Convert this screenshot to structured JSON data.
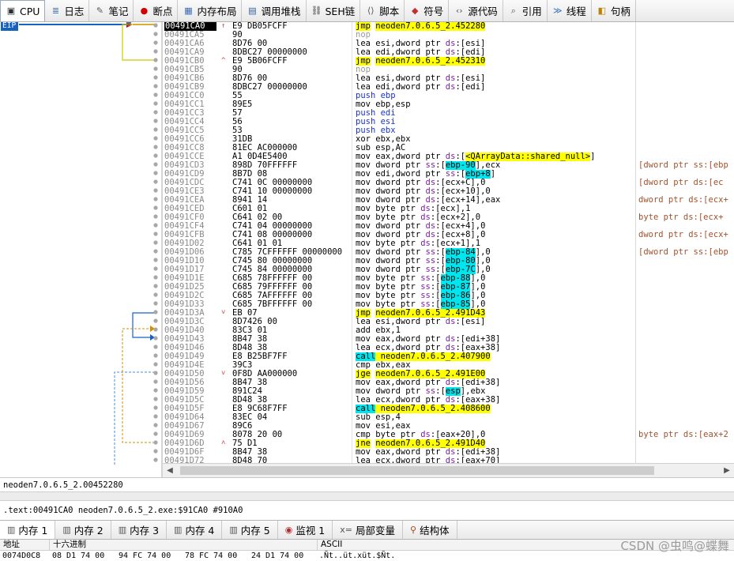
{
  "tabs": [
    {
      "label": "CPU",
      "icon": "cpu-icon",
      "active": true
    },
    {
      "label": "日志",
      "icon": "log-icon"
    },
    {
      "label": "笔记",
      "icon": "notes-icon"
    },
    {
      "label": "断点",
      "icon": "breakpoint-icon"
    },
    {
      "label": "内存布局",
      "icon": "memory-map-icon"
    },
    {
      "label": "调用堆栈",
      "icon": "call-stack-icon"
    },
    {
      "label": "SEH链",
      "icon": "seh-chain-icon"
    },
    {
      "label": "脚本",
      "icon": "script-icon"
    },
    {
      "label": "符号",
      "icon": "symbols-icon"
    },
    {
      "label": "源代码",
      "icon": "source-icon"
    },
    {
      "label": "引用",
      "icon": "references-icon"
    },
    {
      "label": "线程",
      "icon": "threads-icon"
    },
    {
      "label": "句柄",
      "icon": "handles-icon"
    }
  ],
  "eip_label": "EIP",
  "disasm": [
    {
      "addr": "00491CA0",
      "hex": "E9 DB05FCFF",
      "mark": "↑",
      "parts": [
        [
          "jmp",
          "jmp"
        ],
        [
          " "
        ],
        [
          "neoden7.0.6.5_2.452280",
          "jmp"
        ]
      ],
      "sel": true
    },
    {
      "addr": "00491CA5",
      "hex": "90",
      "parts": [
        [
          "nop",
          "nop"
        ]
      ]
    },
    {
      "addr": "00491CA6",
      "hex": "8D76 00",
      "parts": [
        [
          "lea esi,dword ptr "
        ],
        [
          "ds",
          "seg"
        ],
        [
          ":[esi]"
        ]
      ]
    },
    {
      "addr": "00491CA9",
      "hex": "8DBC27 00000000",
      "parts": [
        [
          "lea edi,dword ptr "
        ],
        [
          "ds",
          "seg"
        ],
        [
          ":[edi]"
        ]
      ]
    },
    {
      "addr": "00491CB0",
      "hex": "E9 5B06FCFF",
      "mark": "^",
      "parts": [
        [
          "jmp",
          "jmp"
        ],
        [
          " "
        ],
        [
          "neoden7.0.6.5_2.452310",
          "jmp"
        ]
      ]
    },
    {
      "addr": "00491CB5",
      "hex": "90",
      "parts": [
        [
          "nop",
          "nop"
        ]
      ]
    },
    {
      "addr": "00491CB6",
      "hex": "8D76 00",
      "parts": [
        [
          "lea esi,dword ptr "
        ],
        [
          "ds",
          "seg"
        ],
        [
          ":[esi]"
        ]
      ]
    },
    {
      "addr": "00491CB9",
      "hex": "8DBC27 00000000",
      "parts": [
        [
          "lea edi,dword ptr "
        ],
        [
          "ds",
          "seg"
        ],
        [
          ":[edi]"
        ]
      ]
    },
    {
      "addr": "00491CC0",
      "hex": "55",
      "parts": [
        [
          "push ebp",
          "push"
        ]
      ]
    },
    {
      "addr": "00491CC1",
      "hex": "89E5",
      "parts": [
        [
          "mov ebp,esp"
        ]
      ]
    },
    {
      "addr": "00491CC3",
      "hex": "57",
      "parts": [
        [
          "push edi",
          "push"
        ]
      ]
    },
    {
      "addr": "00491CC4",
      "hex": "56",
      "parts": [
        [
          "push esi",
          "push"
        ]
      ]
    },
    {
      "addr": "00491CC5",
      "hex": "53",
      "parts": [
        [
          "push ebx",
          "push"
        ]
      ]
    },
    {
      "addr": "00491CC6",
      "hex": "31DB",
      "parts": [
        [
          "xor ebx,ebx"
        ]
      ]
    },
    {
      "addr": "00491CC8",
      "hex": "81EC AC000000",
      "parts": [
        [
          "sub esp,AC"
        ]
      ]
    },
    {
      "addr": "00491CCE",
      "hex": "A1 0D4E5400",
      "parts": [
        [
          "mov eax,dword ptr "
        ],
        [
          "ds",
          "seg"
        ],
        [
          ":["
        ],
        [
          "<QArrayData::shared_null>",
          "jmp"
        ],
        [
          "]"
        ]
      ]
    },
    {
      "addr": "00491CD3",
      "hex": "898D 70FFFFFF",
      "cmt": "[dword ptr ss:[ebp",
      "parts": [
        [
          "mov dword ptr "
        ],
        [
          "ss",
          "seg"
        ],
        [
          ":["
        ],
        [
          "ebp-90",
          "hl"
        ],
        [
          "],ecx"
        ]
      ]
    },
    {
      "addr": "00491CD9",
      "hex": "8B7D 08",
      "parts": [
        [
          "mov edi,dword ptr "
        ],
        [
          "ss",
          "seg"
        ],
        [
          ":["
        ],
        [
          "ebp+8",
          "hl"
        ],
        [
          "]"
        ]
      ]
    },
    {
      "addr": "00491CDC",
      "hex": "C741 0C 00000000",
      "cmt": "[dword ptr ds:[ec",
      "parts": [
        [
          "mov dword ptr "
        ],
        [
          "ds",
          "seg"
        ],
        [
          ":[ecx+C],0"
        ]
      ]
    },
    {
      "addr": "00491CE3",
      "hex": "C741 10 00000000",
      "parts": [
        [
          "mov dword ptr "
        ],
        [
          "ds",
          "seg"
        ],
        [
          ":[ecx+10],0"
        ]
      ]
    },
    {
      "addr": "00491CEA",
      "hex": "8941 14",
      "cmt": "dword ptr ds:[ecx+",
      "parts": [
        [
          "mov dword ptr "
        ],
        [
          "ds",
          "seg"
        ],
        [
          ":[ecx+14],eax"
        ]
      ]
    },
    {
      "addr": "00491CED",
      "hex": "C601 01",
      "parts": [
        [
          "mov byte ptr "
        ],
        [
          "ds",
          "seg"
        ],
        [
          ":[ecx],1"
        ]
      ]
    },
    {
      "addr": "00491CF0",
      "hex": "C641 02 00",
      "cmt": "byte ptr ds:[ecx+",
      "parts": [
        [
          "mov byte ptr "
        ],
        [
          "ds",
          "seg"
        ],
        [
          ":[ecx+2],0"
        ]
      ]
    },
    {
      "addr": "00491CF4",
      "hex": "C741 04 00000000",
      "parts": [
        [
          "mov dword ptr "
        ],
        [
          "ds",
          "seg"
        ],
        [
          ":[ecx+4],0"
        ]
      ]
    },
    {
      "addr": "00491CFB",
      "hex": "C741 08 00000000",
      "cmt": "dword ptr ds:[ecx+",
      "parts": [
        [
          "mov dword ptr "
        ],
        [
          "ds",
          "seg"
        ],
        [
          ":[ecx+8],0"
        ]
      ]
    },
    {
      "addr": "00491D02",
      "hex": "C641 01 01",
      "parts": [
        [
          "mov byte ptr "
        ],
        [
          "ds",
          "seg"
        ],
        [
          ":[ecx+1],1"
        ]
      ]
    },
    {
      "addr": "00491D06",
      "hex": "C785 7CFFFFFF 00000000",
      "cmt": "[dword ptr ss:[ebp",
      "parts": [
        [
          "mov dword ptr "
        ],
        [
          "ss",
          "seg"
        ],
        [
          ":["
        ],
        [
          "ebp-84",
          "hl"
        ],
        [
          "],0"
        ]
      ]
    },
    {
      "addr": "00491D10",
      "hex": "C745 80 00000000",
      "parts": [
        [
          "mov dword ptr "
        ],
        [
          "ss",
          "seg"
        ],
        [
          ":["
        ],
        [
          "ebp-80",
          "hl"
        ],
        [
          "],0"
        ]
      ]
    },
    {
      "addr": "00491D17",
      "hex": "C745 84 00000000",
      "parts": [
        [
          "mov dword ptr "
        ],
        [
          "ss",
          "seg"
        ],
        [
          ":["
        ],
        [
          "ebp-7C",
          "hl"
        ],
        [
          "],0"
        ]
      ]
    },
    {
      "addr": "00491D1E",
      "hex": "C685 78FFFFFF 00",
      "parts": [
        [
          "mov byte ptr "
        ],
        [
          "ss",
          "seg"
        ],
        [
          ":["
        ],
        [
          "ebp-88",
          "hl"
        ],
        [
          "],0"
        ]
      ]
    },
    {
      "addr": "00491D25",
      "hex": "C685 79FFFFFF 00",
      "parts": [
        [
          "mov byte ptr "
        ],
        [
          "ss",
          "seg"
        ],
        [
          ":["
        ],
        [
          "ebp-87",
          "hl"
        ],
        [
          "],0"
        ]
      ]
    },
    {
      "addr": "00491D2C",
      "hex": "C685 7AFFFFFF 00",
      "parts": [
        [
          "mov byte ptr "
        ],
        [
          "ss",
          "seg"
        ],
        [
          ":["
        ],
        [
          "ebp-86",
          "hl"
        ],
        [
          "],0"
        ]
      ]
    },
    {
      "addr": "00491D33",
      "hex": "C685 7BFFFFFF 00",
      "parts": [
        [
          "mov byte ptr "
        ],
        [
          "ss",
          "seg"
        ],
        [
          ":["
        ],
        [
          "ebp-85",
          "hl"
        ],
        [
          "],0"
        ]
      ]
    },
    {
      "addr": "00491D3A",
      "hex": "EB 07",
      "mark": "˅",
      "parts": [
        [
          "jmp",
          "jmp"
        ],
        [
          " "
        ],
        [
          "neoden7.0.6.5_2.491D43",
          "jmp"
        ]
      ]
    },
    {
      "addr": "00491D3C",
      "hex": "8D7426 00",
      "parts": [
        [
          "lea esi,dword ptr "
        ],
        [
          "ds",
          "seg"
        ],
        [
          ":[esi]"
        ]
      ]
    },
    {
      "addr": "00491D40",
      "hex": "83C3 01",
      "parts": [
        [
          "add ebx,1"
        ]
      ]
    },
    {
      "addr": "00491D43",
      "hex": "8B47 38",
      "parts": [
        [
          "mov eax,dword ptr "
        ],
        [
          "ds",
          "seg"
        ],
        [
          ":[edi+38]"
        ]
      ]
    },
    {
      "addr": "00491D46",
      "hex": "8D48 38",
      "parts": [
        [
          "lea ecx,dword ptr "
        ],
        [
          "ds",
          "seg"
        ],
        [
          ":[eax+38]"
        ]
      ]
    },
    {
      "addr": "00491D49",
      "hex": "E8 B25BF7FF",
      "parts": [
        [
          "call",
          "call"
        ],
        [
          " neoden7.0.6.5_2.407900",
          "jmp"
        ]
      ]
    },
    {
      "addr": "00491D4E",
      "hex": "39C3",
      "parts": [
        [
          "cmp ebx,eax"
        ]
      ]
    },
    {
      "addr": "00491D50",
      "hex": "0F8D AA000000",
      "mark": "˅",
      "parts": [
        [
          "jge",
          "jcc"
        ],
        [
          " "
        ],
        [
          "neoden7.0.6.5_2.491E00",
          "jmp"
        ]
      ]
    },
    {
      "addr": "00491D56",
      "hex": "8B47 38",
      "parts": [
        [
          "mov eax,dword ptr "
        ],
        [
          "ds",
          "seg"
        ],
        [
          ":[edi+38]"
        ]
      ]
    },
    {
      "addr": "00491D59",
      "hex": "891C24",
      "parts": [
        [
          "mov dword ptr "
        ],
        [
          "ss",
          "seg"
        ],
        [
          ":["
        ],
        [
          "esp",
          "hl"
        ],
        [
          "],ebx"
        ]
      ]
    },
    {
      "addr": "00491D5C",
      "hex": "8D48 38",
      "parts": [
        [
          "lea ecx,dword ptr "
        ],
        [
          "ds",
          "seg"
        ],
        [
          ":[eax+38]"
        ]
      ]
    },
    {
      "addr": "00491D5F",
      "hex": "E8 9C68F7FF",
      "parts": [
        [
          "call",
          "call"
        ],
        [
          " neoden7.0.6.5_2.408600",
          "jmp"
        ]
      ]
    },
    {
      "addr": "00491D64",
      "hex": "83EC 04",
      "parts": [
        [
          "sub esp,4"
        ]
      ]
    },
    {
      "addr": "00491D67",
      "hex": "89C6",
      "parts": [
        [
          "mov esi,eax"
        ]
      ]
    },
    {
      "addr": "00491D69",
      "hex": "8078 20 00",
      "cmt": "byte ptr ds:[eax+2",
      "parts": [
        [
          "cmp byte ptr "
        ],
        [
          "ds",
          "seg"
        ],
        [
          ":[eax+20],0"
        ]
      ]
    },
    {
      "addr": "00491D6D",
      "hex": "75 D1",
      "mark": "˄",
      "parts": [
        [
          "jne",
          "jcc"
        ],
        [
          " "
        ],
        [
          "neoden7.0.6.5_2.491D40",
          "jmp"
        ]
      ]
    },
    {
      "addr": "00491D6F",
      "hex": "8B47 38",
      "parts": [
        [
          "mov eax,dword ptr "
        ],
        [
          "ds",
          "seg"
        ],
        [
          ":[edi+38]"
        ]
      ]
    },
    {
      "addr": "00491D72",
      "hex": "8D48 70",
      "parts": [
        [
          "lea ecx,dword ptr "
        ],
        [
          "ds",
          "seg"
        ],
        [
          ":[eax+70]"
        ]
      ]
    }
  ],
  "info": {
    "line1": "neoden7.0.6.5_2.00452280",
    "line2": ".text:00491CA0 neoden7.0.6.5_2.exe:$91CA0 #910A0"
  },
  "bottom_tabs": [
    {
      "label": "内存 1",
      "icon": "memory-icon",
      "active": true
    },
    {
      "label": "内存 2",
      "icon": "memory-icon"
    },
    {
      "label": "内存 3",
      "icon": "memory-icon"
    },
    {
      "label": "内存 4",
      "icon": "memory-icon"
    },
    {
      "label": "内存 5",
      "icon": "memory-icon"
    },
    {
      "label": "监视 1",
      "icon": "watch-icon"
    },
    {
      "label": "局部变量",
      "icon": "locals-icon"
    },
    {
      "label": "结构体",
      "icon": "struct-icon"
    }
  ],
  "dump": {
    "headers": {
      "address": "地址",
      "hex": "十六进制",
      "ascii": "ASCII"
    },
    "row": {
      "address": "0074D0C8",
      "bytes": [
        "08 D1 74 00",
        "94 FC 74 00",
        "78 FC 74 00",
        "24 D1 74 00"
      ],
      "ascii": ".Ñt..üt.xüt.$Ñt."
    }
  },
  "watermark": "CSDN @虫鸣@蝶舞",
  "colors": {
    "accent": "#1562c3",
    "jump_highlight": "#ffff00",
    "call_highlight": "#00e5ee",
    "segment": "#7a1fa0"
  }
}
